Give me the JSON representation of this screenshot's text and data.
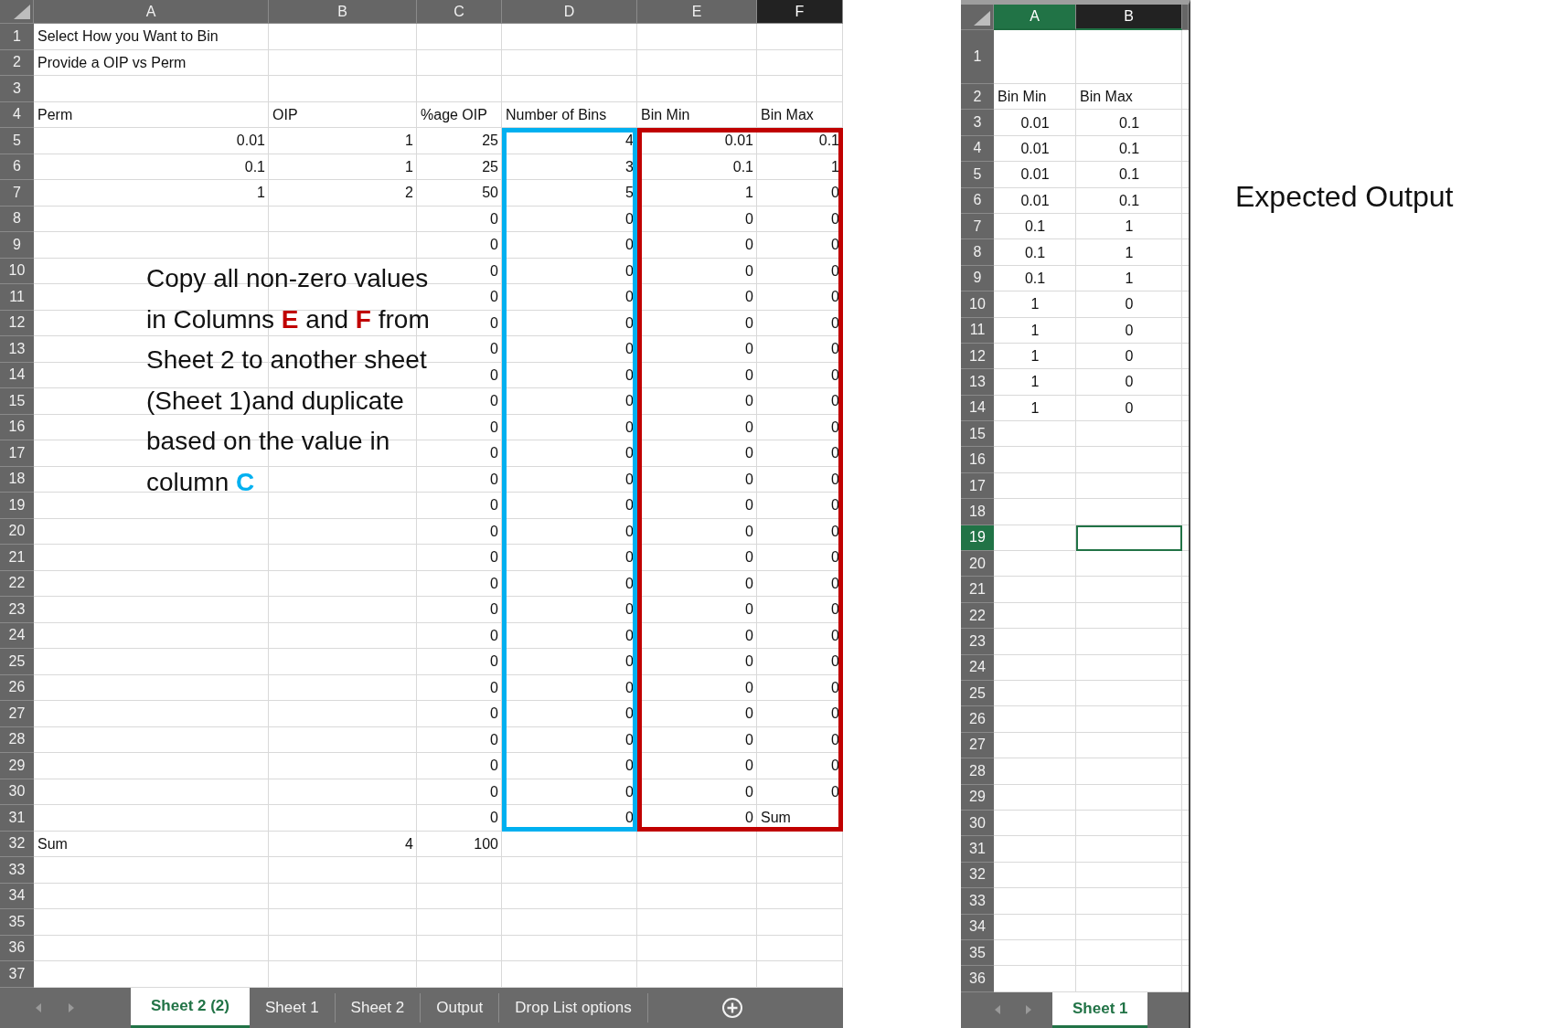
{
  "left_sheet": {
    "columns": [
      {
        "label": "A",
        "kind": "plain"
      },
      {
        "label": "B",
        "kind": "plain"
      },
      {
        "label": "C",
        "kind": "plain"
      },
      {
        "label": "D",
        "kind": "plain"
      },
      {
        "label": "E",
        "kind": "plain"
      },
      {
        "label": "F",
        "kind": "dark"
      }
    ],
    "rows": [
      {
        "number": "1",
        "cells": [
          {
            "text": "Select How you Want to Bin",
            "kind": "label"
          }
        ]
      },
      {
        "number": "2",
        "cells": [
          {
            "text": "Provide a OIP vs Perm",
            "kind": "label"
          }
        ]
      },
      {
        "number": "3",
        "cells": []
      },
      {
        "number": "4",
        "cells": [
          {
            "text": "Perm",
            "kind": "label"
          },
          {
            "text": "OIP",
            "kind": "label"
          },
          {
            "text": "%age OIP",
            "kind": "label"
          },
          {
            "text": "Number of Bins",
            "kind": "label"
          },
          {
            "text": "Bin Min",
            "kind": "label"
          },
          {
            "text": "Bin Max",
            "kind": "label"
          }
        ]
      },
      {
        "number": "5",
        "cells": [
          "0.01",
          "1",
          "25",
          "4",
          "0.01",
          "0.1"
        ]
      },
      {
        "number": "6",
        "cells": [
          "0.1",
          "1",
          "25",
          "3",
          "0.1",
          "1"
        ]
      },
      {
        "number": "7",
        "cells": [
          "1",
          "2",
          "50",
          "5",
          "1",
          "0"
        ]
      },
      {
        "number": "8",
        "cells": [
          null,
          null,
          "0",
          "0",
          "0",
          "0"
        ]
      },
      {
        "number": "9",
        "cells": [
          null,
          null,
          "0",
          "0",
          "0",
          "0"
        ]
      },
      {
        "number": "10",
        "cells": [
          null,
          null,
          "0",
          "0",
          "0",
          "0"
        ]
      },
      {
        "number": "11",
        "cells": [
          null,
          null,
          "0",
          "0",
          "0",
          "0"
        ]
      },
      {
        "number": "12",
        "cells": [
          null,
          null,
          "0",
          "0",
          "0",
          "0"
        ]
      },
      {
        "number": "13",
        "cells": [
          null,
          null,
          "0",
          "0",
          "0",
          "0"
        ]
      },
      {
        "number": "14",
        "cells": [
          null,
          null,
          "0",
          "0",
          "0",
          "0"
        ]
      },
      {
        "number": "15",
        "cells": [
          null,
          null,
          "0",
          "0",
          "0",
          "0"
        ]
      },
      {
        "number": "16",
        "cells": [
          null,
          null,
          "0",
          "0",
          "0",
          "0"
        ]
      },
      {
        "number": "17",
        "cells": [
          null,
          null,
          "0",
          "0",
          "0",
          "0"
        ]
      },
      {
        "number": "18",
        "cells": [
          null,
          null,
          "0",
          "0",
          "0",
          "0"
        ]
      },
      {
        "number": "19",
        "cells": [
          null,
          null,
          "0",
          "0",
          "0",
          "0"
        ]
      },
      {
        "number": "20",
        "cells": [
          null,
          null,
          "0",
          "0",
          "0",
          "0"
        ]
      },
      {
        "number": "21",
        "cells": [
          null,
          null,
          "0",
          "0",
          "0",
          "0"
        ]
      },
      {
        "number": "22",
        "cells": [
          null,
          null,
          "0",
          "0",
          "0",
          "0"
        ]
      },
      {
        "number": "23",
        "cells": [
          null,
          null,
          "0",
          "0",
          "0",
          "0"
        ]
      },
      {
        "number": "24",
        "cells": [
          null,
          null,
          "0",
          "0",
          "0",
          "0"
        ]
      },
      {
        "number": "25",
        "cells": [
          null,
          null,
          "0",
          "0",
          "0",
          "0"
        ]
      },
      {
        "number": "26",
        "cells": [
          null,
          null,
          "0",
          "0",
          "0",
          "0"
        ]
      },
      {
        "number": "27",
        "cells": [
          null,
          null,
          "0",
          "0",
          "0",
          "0"
        ]
      },
      {
        "number": "28",
        "cells": [
          null,
          null,
          "0",
          "0",
          "0",
          "0"
        ]
      },
      {
        "number": "29",
        "cells": [
          null,
          null,
          "0",
          "0",
          "0",
          "0"
        ]
      },
      {
        "number": "30",
        "cells": [
          null,
          null,
          "0",
          "0",
          "0",
          "0"
        ]
      },
      {
        "number": "31",
        "cells": [
          null,
          null,
          "0",
          "0",
          "0",
          {
            "text": "Sum",
            "kind": "label"
          }
        ]
      },
      {
        "number": "32",
        "cells": [
          {
            "text": "Sum",
            "kind": "label"
          },
          "4",
          "100"
        ]
      },
      {
        "number": "33",
        "cells": []
      },
      {
        "number": "34",
        "cells": []
      },
      {
        "number": "35",
        "cells": []
      },
      {
        "number": "36",
        "cells": []
      },
      {
        "number": "37",
        "cells": []
      }
    ],
    "highlights": [
      {
        "color": "#00b0f0"
      },
      {
        "color": "#c00000"
      }
    ],
    "note": {
      "runs": [
        {
          "text": "Copy all non-zero values in Columns "
        },
        {
          "text": "E",
          "color": "#c00000"
        },
        {
          "text": " and "
        },
        {
          "text": "F",
          "color": "#c00000"
        },
        {
          "text": " from Sheet 2 to another sheet (Sheet 1)and duplicate based on the value in column "
        },
        {
          "text": "C",
          "color": "#00b0f0"
        }
      ]
    },
    "sheet_tabs": [
      {
        "label": "Sheet 2 (2)",
        "selected": true
      },
      {
        "label": "Sheet 1",
        "selected": false
      },
      {
        "label": "Sheet 2",
        "selected": false
      },
      {
        "label": "Output",
        "selected": false
      },
      {
        "label": "Drop List options",
        "selected": false
      }
    ]
  },
  "right_sheet": {
    "columns": [
      {
        "label": "A",
        "kind": "active"
      },
      {
        "label": "B",
        "kind": "dark"
      }
    ],
    "rows": [
      {
        "number": "1",
        "selected": false,
        "cells": []
      },
      {
        "number": "2",
        "selected": false,
        "cells": [
          {
            "text": "Bin Min",
            "kind": "label"
          },
          {
            "text": "Bin Max",
            "kind": "label"
          }
        ]
      },
      {
        "number": "3",
        "selected": false,
        "cells": [
          "0.01",
          "0.1"
        ]
      },
      {
        "number": "4",
        "selected": false,
        "cells": [
          "0.01",
          "0.1"
        ]
      },
      {
        "number": "5",
        "selected": false,
        "cells": [
          "0.01",
          "0.1"
        ]
      },
      {
        "number": "6",
        "selected": false,
        "cells": [
          "0.01",
          "0.1"
        ]
      },
      {
        "number": "7",
        "selected": false,
        "cells": [
          "0.1",
          "1"
        ]
      },
      {
        "number": "8",
        "selected": false,
        "cells": [
          "0.1",
          "1"
        ]
      },
      {
        "number": "9",
        "selected": false,
        "cells": [
          "0.1",
          "1"
        ]
      },
      {
        "number": "10",
        "selected": false,
        "cells": [
          "1",
          "0"
        ]
      },
      {
        "number": "11",
        "selected": false,
        "cells": [
          "1",
          "0"
        ]
      },
      {
        "number": "12",
        "selected": false,
        "cells": [
          "1",
          "0"
        ]
      },
      {
        "number": "13",
        "selected": false,
        "cells": [
          "1",
          "0"
        ]
      },
      {
        "number": "14",
        "selected": false,
        "cells": [
          "1",
          "0"
        ]
      },
      {
        "number": "15",
        "selected": false,
        "cells": []
      },
      {
        "number": "16",
        "selected": false,
        "cells": []
      },
      {
        "number": "17",
        "selected": false,
        "cells": []
      },
      {
        "number": "18",
        "selected": false,
        "cells": []
      },
      {
        "number": "19",
        "selected": true,
        "cells": [
          null,
          {
            "kind": "cursor"
          }
        ]
      },
      {
        "number": "20",
        "selected": false,
        "cells": []
      },
      {
        "number": "21",
        "selected": false,
        "cells": []
      },
      {
        "number": "22",
        "selected": false,
        "cells": []
      },
      {
        "number": "23",
        "selected": false,
        "cells": []
      },
      {
        "number": "24",
        "selected": false,
        "cells": []
      },
      {
        "number": "25",
        "selected": false,
        "cells": []
      },
      {
        "number": "26",
        "selected": false,
        "cells": []
      },
      {
        "number": "27",
        "selected": false,
        "cells": []
      },
      {
        "number": "28",
        "selected": false,
        "cells": []
      },
      {
        "number": "29",
        "selected": false,
        "cells": []
      },
      {
        "number": "30",
        "selected": false,
        "cells": []
      },
      {
        "number": "31",
        "selected": false,
        "cells": []
      },
      {
        "number": "32",
        "selected": false,
        "cells": []
      },
      {
        "number": "33",
        "selected": false,
        "cells": []
      },
      {
        "number": "34",
        "selected": false,
        "cells": []
      },
      {
        "number": "35",
        "selected": false,
        "cells": []
      },
      {
        "number": "36",
        "selected": false,
        "cells": []
      }
    ],
    "sheet_tabs": [
      {
        "label": "Sheet 1",
        "selected": true
      }
    ]
  },
  "caption": "Expected Output"
}
